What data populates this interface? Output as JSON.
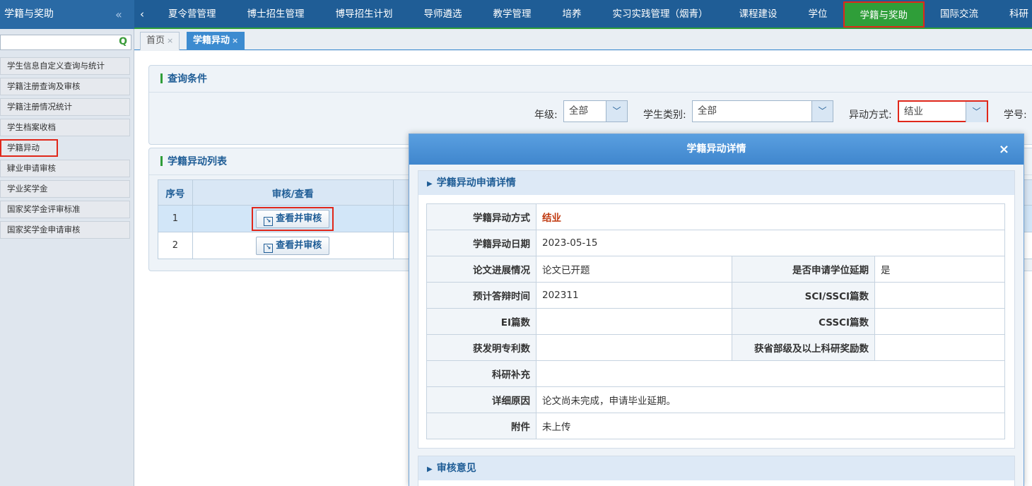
{
  "sidebar": {
    "title": "学籍与奖助",
    "collapse_icon": "«",
    "items": [
      {
        "label": "学生信息自定义查询与统计"
      },
      {
        "label": "学籍注册查询及审核"
      },
      {
        "label": "学籍注册情况统计"
      },
      {
        "label": "学生档案收档"
      },
      {
        "label": "学籍异动"
      },
      {
        "label": "肄业申请审核"
      },
      {
        "label": "学业奖学金"
      },
      {
        "label": "国家奖学金评审标准"
      },
      {
        "label": "国家奖学金申请审核"
      }
    ]
  },
  "topnav": {
    "back_icon": "‹",
    "items": [
      "夏令营管理",
      "博士招生管理",
      "博导招生计划",
      "导师遴选",
      "教学管理",
      "培养",
      "实习实践管理（烟青）",
      "课程建设",
      "学位",
      "学籍与奖助",
      "国际交流",
      "科研"
    ],
    "active": "学籍与奖助"
  },
  "tabs": [
    {
      "label": "首页",
      "close": "×"
    },
    {
      "label": "学籍异动",
      "close": "×"
    }
  ],
  "query": {
    "title": "查询条件",
    "grade_label": "年级:",
    "grade_value": "全部",
    "type_label": "学生类别:",
    "type_value": "全部",
    "change_label": "异动方式:",
    "change_value": "结业",
    "id_label": "学号:"
  },
  "list": {
    "title": "学籍异动列表",
    "col_no": "序号",
    "col_action": "审核/查看",
    "rows": [
      {
        "no": "1",
        "action": "查看并审核"
      },
      {
        "no": "2",
        "action": "查看并审核"
      }
    ]
  },
  "modal": {
    "title": "学籍异动详情",
    "close": "×",
    "section1": "学籍异动申请详情",
    "section2": "审核意见",
    "fields": {
      "change_type_k": "学籍异动方式",
      "change_type_v": "结业",
      "change_date_k": "学籍异动日期",
      "change_date_v": "2023-05-15",
      "thesis_k": "论文进展情况",
      "thesis_v": "论文已开题",
      "delay_k": "是否申请学位延期",
      "delay_v": "是",
      "defense_k": "预计答辩时间",
      "defense_v": "202311",
      "sci_k": "SCI/SSCI篇数",
      "sci_v": "",
      "ei_k": "EI篇数",
      "ei_v": "",
      "cssci_k": "CSSCI篇数",
      "cssci_v": "",
      "patent_k": "获发明专利数",
      "patent_v": "",
      "award_k": "获省部级及以上科研奖励数",
      "award_v": "",
      "extra_k": "科研补充",
      "extra_v": "",
      "reason_k": "详细原因",
      "reason_v": "论文尚未完成，申请毕业延期。",
      "attach_k": "附件",
      "attach_v": "未上传"
    }
  }
}
